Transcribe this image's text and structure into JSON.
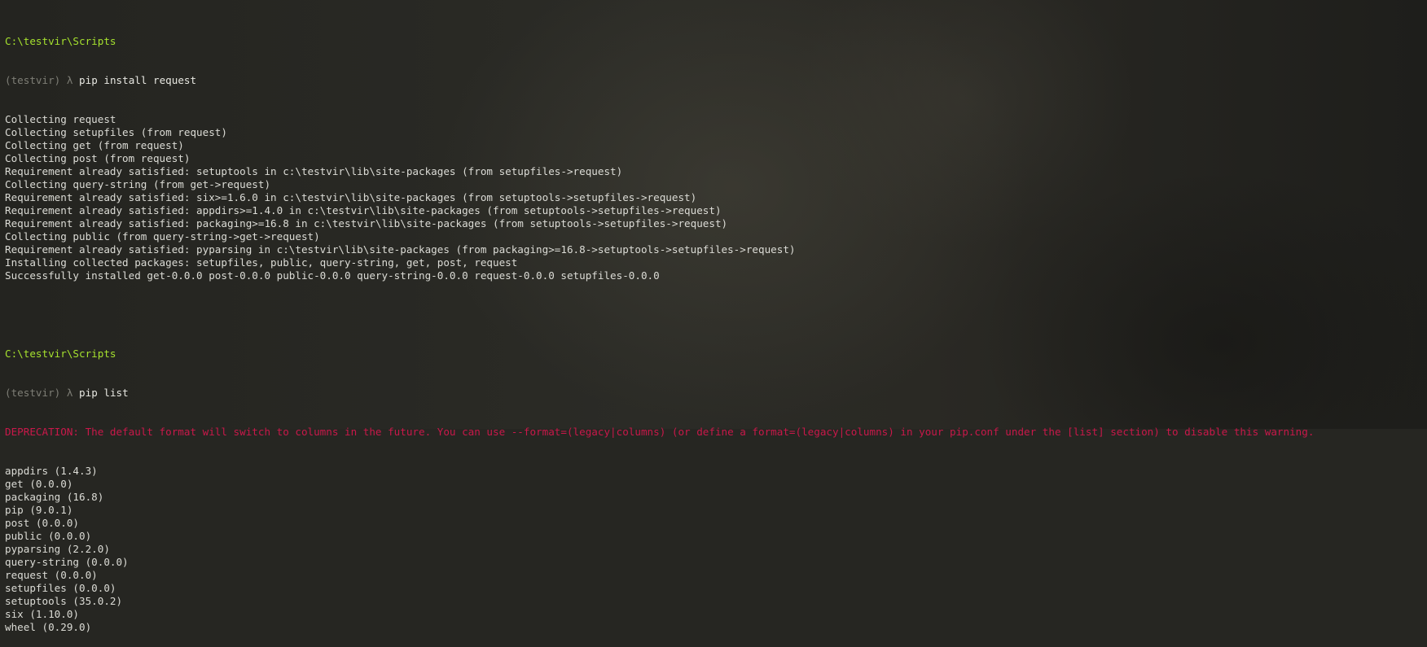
{
  "session1": {
    "prompt_path": "C:\\testvir\\Scripts",
    "venv": "(testvir)",
    "lambda": "λ",
    "command": "pip install request",
    "output": [
      "Collecting request",
      "Collecting setupfiles (from request)",
      "Collecting get (from request)",
      "Collecting post (from request)",
      "Requirement already satisfied: setuptools in c:\\testvir\\lib\\site-packages (from setupfiles->request)",
      "Collecting query-string (from get->request)",
      "Requirement already satisfied: six>=1.6.0 in c:\\testvir\\lib\\site-packages (from setuptools->setupfiles->request)",
      "Requirement already satisfied: appdirs>=1.4.0 in c:\\testvir\\lib\\site-packages (from setuptools->setupfiles->request)",
      "Requirement already satisfied: packaging>=16.8 in c:\\testvir\\lib\\site-packages (from setuptools->setupfiles->request)",
      "Collecting public (from query-string->get->request)",
      "Requirement already satisfied: pyparsing in c:\\testvir\\lib\\site-packages (from packaging>=16.8->setuptools->setupfiles->request)",
      "Installing collected packages: setupfiles, public, query-string, get, post, request",
      "Successfully installed get-0.0.0 post-0.0.0 public-0.0.0 query-string-0.0.0 request-0.0.0 setupfiles-0.0.0"
    ]
  },
  "session2": {
    "prompt_path": "C:\\testvir\\Scripts",
    "venv": "(testvir)",
    "lambda": "λ",
    "command": "pip list",
    "deprecation": "DEPRECATION: The default format will switch to columns in the future. You can use --format=(legacy|columns) (or define a format=(legacy|columns) in your pip.conf under the [list] section) to disable this warning.",
    "output": [
      "appdirs (1.4.3)",
      "get (0.0.0)",
      "packaging (16.8)",
      "pip (9.0.1)",
      "post (0.0.0)",
      "public (0.0.0)",
      "pyparsing (2.2.0)",
      "query-string (0.0.0)",
      "request (0.0.0)",
      "setupfiles (0.0.0)",
      "setuptools (35.0.2)",
      "six (1.10.0)",
      "wheel (0.29.0)"
    ]
  },
  "colors": {
    "background": "#262622",
    "text": "#dcdcd6",
    "path": "#a6e22e",
    "prompt_dim": "#7e7e76",
    "deprecation": "#c9184a"
  }
}
